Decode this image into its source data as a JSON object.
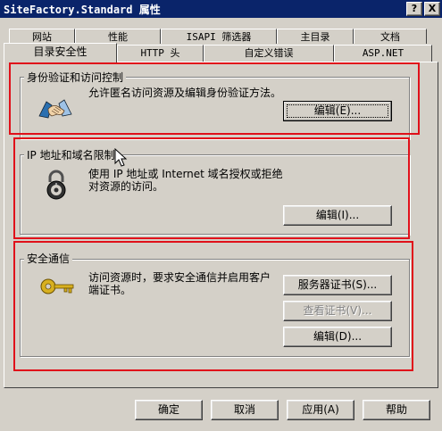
{
  "window": {
    "title": "SiteFactory.Standard 属性",
    "help_button": "?",
    "close_button": "X"
  },
  "tabs": {
    "row1": [
      "网站",
      "性能",
      "ISAPI 筛选器",
      "主目录",
      "文档"
    ],
    "row2": [
      "目录安全性",
      "HTTP 头",
      "自定义错误",
      "ASP.NET"
    ],
    "active": "目录安全性"
  },
  "auth": {
    "title": "身份验证和访问控制",
    "description": "允许匿名访问资源及编辑身份验证方法。",
    "edit_button": "编辑(E)...",
    "icon": "handshake-icon"
  },
  "ip": {
    "title": "IP 地址和域名限制",
    "description": "使用 IP 地址或 Internet 域名授权或拒绝对资源的访问。",
    "edit_button": "编辑(I)...",
    "icon": "lock-icon"
  },
  "secure": {
    "title": "安全通信",
    "description": "访问资源时，要求安全通信并启用客户端证书。",
    "server_cert_button": "服务器证书(S)...",
    "view_cert_button": "查看证书(V)...",
    "edit_button": "编辑(D)...",
    "icon": "key-icon"
  },
  "footer": {
    "ok": "确定",
    "cancel": "取消",
    "apply": "应用(A)",
    "help": "帮助"
  },
  "highlight_color": "#e0101a"
}
